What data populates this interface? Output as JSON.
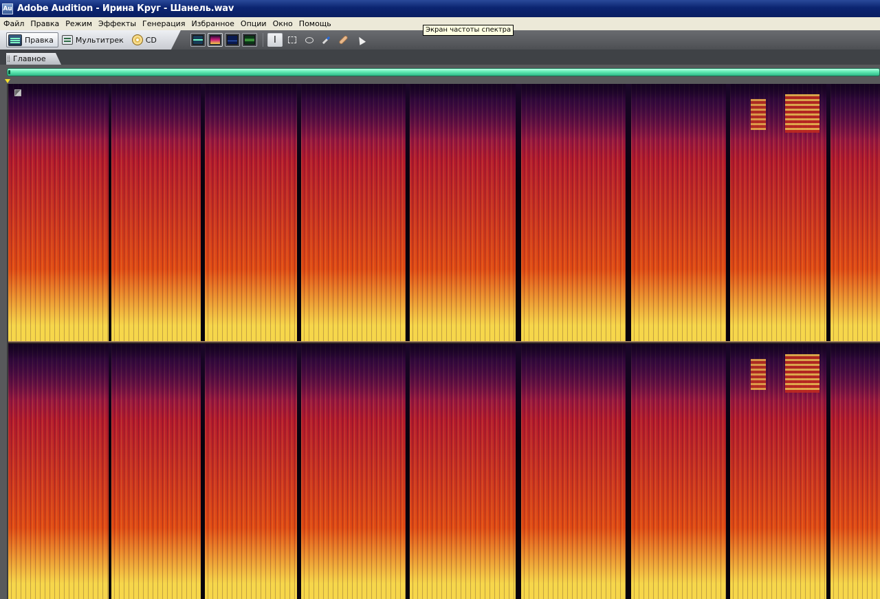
{
  "window": {
    "app_icon_text": "Au",
    "title": "Adobe Audition - Ирина Круг - Шанель.wav"
  },
  "menu": [
    "Файл",
    "Правка",
    "Режим",
    "Эффекты",
    "Генерация",
    "Избранное",
    "Опции",
    "Окно",
    "Помощь"
  ],
  "tooltip": "Экран частоты спектра",
  "workspaces": {
    "edit": "Правка",
    "multitrack": "Мультитрек",
    "cd": "CD",
    "active": "edit"
  },
  "view_modes": [
    "waveform-display",
    "spectral-frequency-display",
    "spectral-pan-display",
    "spectral-pitch-display"
  ],
  "active_view_mode": "spectral-frequency-display",
  "tools": [
    "time-selection",
    "marquee-selection",
    "lasso-selection",
    "effects-paintbrush",
    "spot-healing-brush",
    "scrub"
  ],
  "active_tool": "time-selection",
  "panel_tab": "Главное",
  "spectral_view": {
    "channels": 2,
    "colors": {
      "quiet": "#140320",
      "low": "#5b0f64",
      "mid": "#b31a2c",
      "high": "#e04a14",
      "peak": "#f6d64a"
    }
  }
}
